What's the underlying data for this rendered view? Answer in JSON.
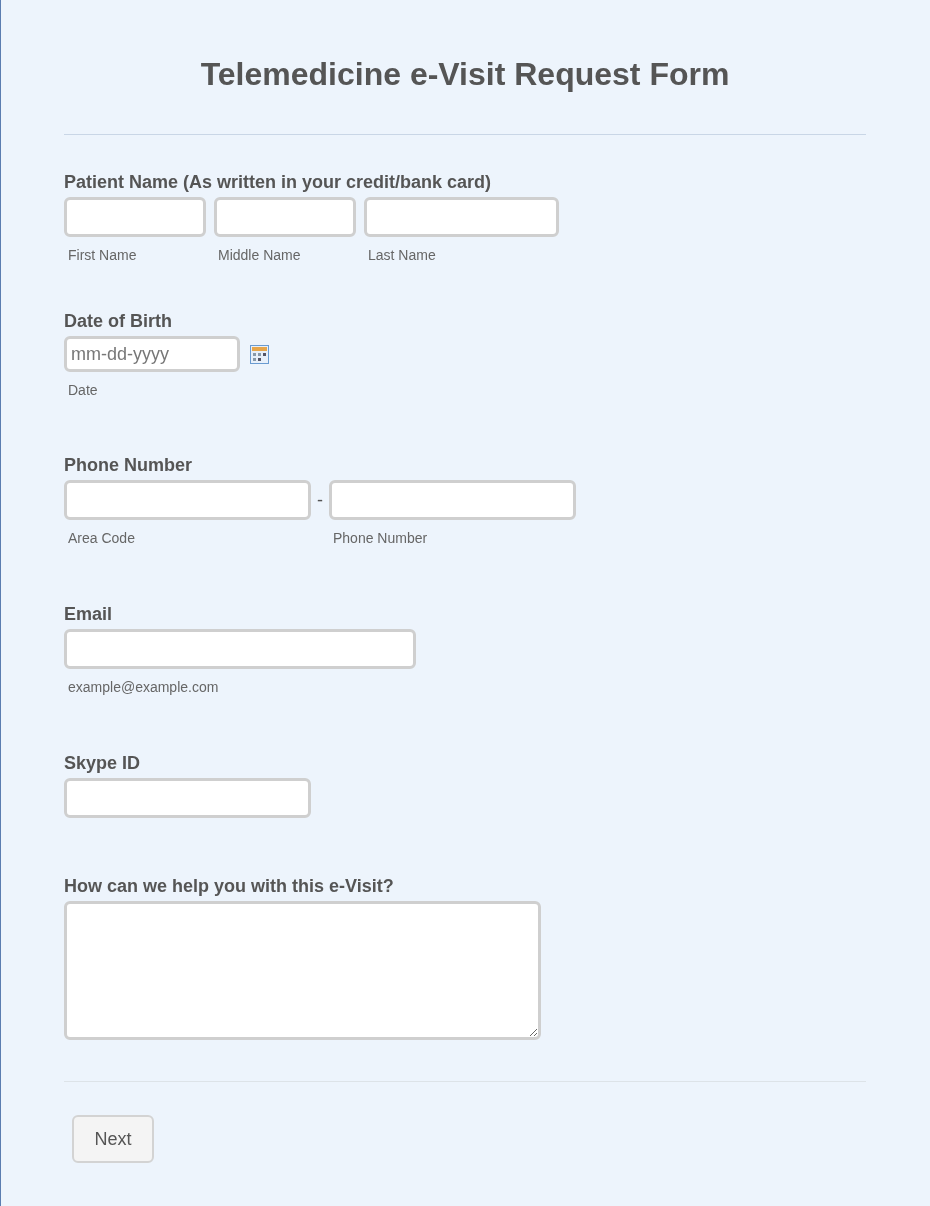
{
  "title": "Telemedicine e-Visit Request Form",
  "sections": [
    {
      "kind": "name",
      "label": "Patient Name (As written in your credit/bank card)",
      "inputs": [
        {
          "sublabel": "First Name"
        },
        {
          "sublabel": "Middle Name"
        },
        {
          "sublabel": "Last Name"
        }
      ]
    },
    {
      "kind": "date",
      "label": "Date of Birth",
      "inputs": [
        {
          "placeholder": "mm-dd-yyyy",
          "sublabel": "Date"
        }
      ]
    },
    {
      "kind": "phone",
      "label": "Phone Number",
      "separator": "-",
      "inputs": [
        {
          "sublabel": "Area Code"
        },
        {
          "sublabel": "Phone Number"
        }
      ]
    },
    {
      "kind": "email",
      "label": "Email",
      "inputs": [
        {
          "sublabel": "example@example.com"
        }
      ]
    },
    {
      "kind": "text",
      "label": "Skype ID"
    },
    {
      "kind": "textarea",
      "label": "How can we help you with this e-Visit?"
    }
  ],
  "buttons": [
    {
      "label": "Next"
    }
  ]
}
